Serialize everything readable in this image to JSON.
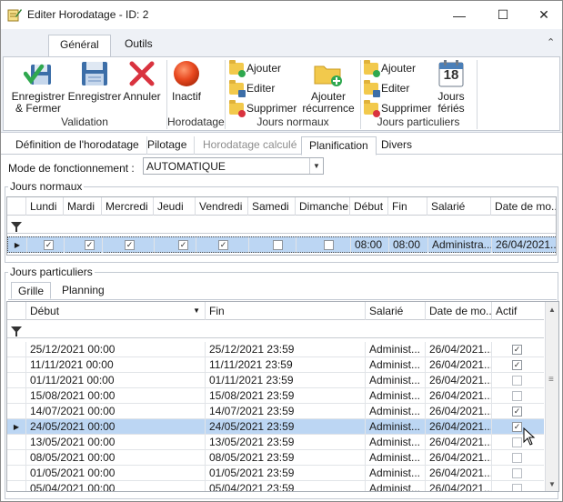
{
  "window": {
    "title": "Editer Horodatage - ID: 2",
    "minimize": "—",
    "maximize": "☐",
    "close": "✕"
  },
  "ribbon": {
    "tabs": [
      {
        "label": "Général",
        "active": true
      },
      {
        "label": "Outils",
        "active": false
      }
    ],
    "collapse": "⌃",
    "groups": {
      "validation": {
        "label": "Validation",
        "save_close": "Enregistrer\n& Fermer",
        "save": "Enregistrer",
        "cancel": "Annuler"
      },
      "horodatage": {
        "label": "Horodatage",
        "inactive": "Inactif"
      },
      "jours_normaux": {
        "label": "Jours normaux",
        "add": "Ajouter",
        "edit": "Editer",
        "delete": "Supprimer",
        "add_recurrence": "Ajouter\nrécurrence"
      },
      "jours_particuliers": {
        "label": "Jours particuliers",
        "add": "Ajouter",
        "edit": "Editer",
        "delete": "Supprimer",
        "holidays": "Jours\nfériés",
        "calendar_number": "18"
      }
    }
  },
  "subtabs": [
    {
      "label": "Définition de l'horodatage",
      "state": "normal"
    },
    {
      "label": "Pilotage",
      "state": "normal"
    },
    {
      "label": "Horodatage calculé",
      "state": "disabled"
    },
    {
      "label": "Planification",
      "state": "active"
    },
    {
      "label": "Divers",
      "state": "normal"
    }
  ],
  "mode": {
    "label": "Mode de fonctionnement :",
    "value": "AUTOMATIQUE"
  },
  "jours_normaux": {
    "legend": "Jours normaux",
    "columns": [
      "Lundi",
      "Mardi",
      "Mercredi",
      "Jeudi",
      "Vendredi",
      "Samedi",
      "Dimanche",
      "Début",
      "Fin",
      "Salarié",
      "Date de mo..."
    ],
    "row": {
      "days": [
        true,
        true,
        true,
        true,
        true,
        false,
        false
      ],
      "debut": "08:00",
      "fin": "08:00",
      "salarie": "Administra...",
      "date": "26/04/2021..."
    }
  },
  "jours_particuliers": {
    "legend": "Jours particuliers",
    "tabs": [
      {
        "label": "Grille",
        "active": true
      },
      {
        "label": "Planning",
        "active": false
      }
    ],
    "columns": [
      "Début",
      "Fin",
      "Salarié",
      "Date de mo...",
      "Actif"
    ],
    "rows": [
      {
        "debut": "25/12/2021 00:00",
        "fin": "25/12/2021 23:59",
        "salarie": "Administ...",
        "date": "26/04/2021...",
        "actif": true,
        "selected": false
      },
      {
        "debut": "11/11/2021 00:00",
        "fin": "11/11/2021 23:59",
        "salarie": "Administ...",
        "date": "26/04/2021...",
        "actif": true,
        "selected": false
      },
      {
        "debut": "01/11/2021 00:00",
        "fin": "01/11/2021 23:59",
        "salarie": "Administ...",
        "date": "26/04/2021...",
        "actif": false,
        "selected": false
      },
      {
        "debut": "15/08/2021 00:00",
        "fin": "15/08/2021 23:59",
        "salarie": "Administ...",
        "date": "26/04/2021...",
        "actif": false,
        "selected": false
      },
      {
        "debut": "14/07/2021 00:00",
        "fin": "14/07/2021 23:59",
        "salarie": "Administ...",
        "date": "26/04/2021...",
        "actif": true,
        "selected": false
      },
      {
        "debut": "24/05/2021 00:00",
        "fin": "24/05/2021 23:59",
        "salarie": "Administ...",
        "date": "26/04/2021...",
        "actif": true,
        "selected": true
      },
      {
        "debut": "13/05/2021 00:00",
        "fin": "13/05/2021 23:59",
        "salarie": "Administ...",
        "date": "26/04/2021...",
        "actif": false,
        "selected": false
      },
      {
        "debut": "08/05/2021 00:00",
        "fin": "08/05/2021 23:59",
        "salarie": "Administ...",
        "date": "26/04/2021...",
        "actif": false,
        "selected": false
      },
      {
        "debut": "01/05/2021 00:00",
        "fin": "01/05/2021 23:59",
        "salarie": "Administ...",
        "date": "26/04/2021...",
        "actif": false,
        "selected": false
      },
      {
        "debut": "05/04/2021 00:00",
        "fin": "05/04/2021 23:59",
        "salarie": "Administ...",
        "date": "26/04/2021...",
        "actif": false,
        "selected": false
      }
    ]
  },
  "colors": {
    "accent_blue": "#2b6cb0",
    "selection": "#bcd6f3",
    "ribbon_bg": "#eef1f6",
    "check_green": "#2fa84f",
    "cancel_red": "#d9333f",
    "inactive_red": "#e8481f",
    "folder_yellow": "#f2c94c"
  },
  "icons": {
    "app": "notepad-pencil-icon",
    "save_close": "check-floppy-icon",
    "save": "floppy-disk-icon",
    "cancel": "red-x-icon",
    "inactive": "red-circle-icon",
    "add": "folder-plus-icon",
    "edit": "folder-pencil-icon",
    "delete": "folder-minus-icon",
    "holidays": "calendar-icon",
    "filter": "funnel-icon"
  }
}
